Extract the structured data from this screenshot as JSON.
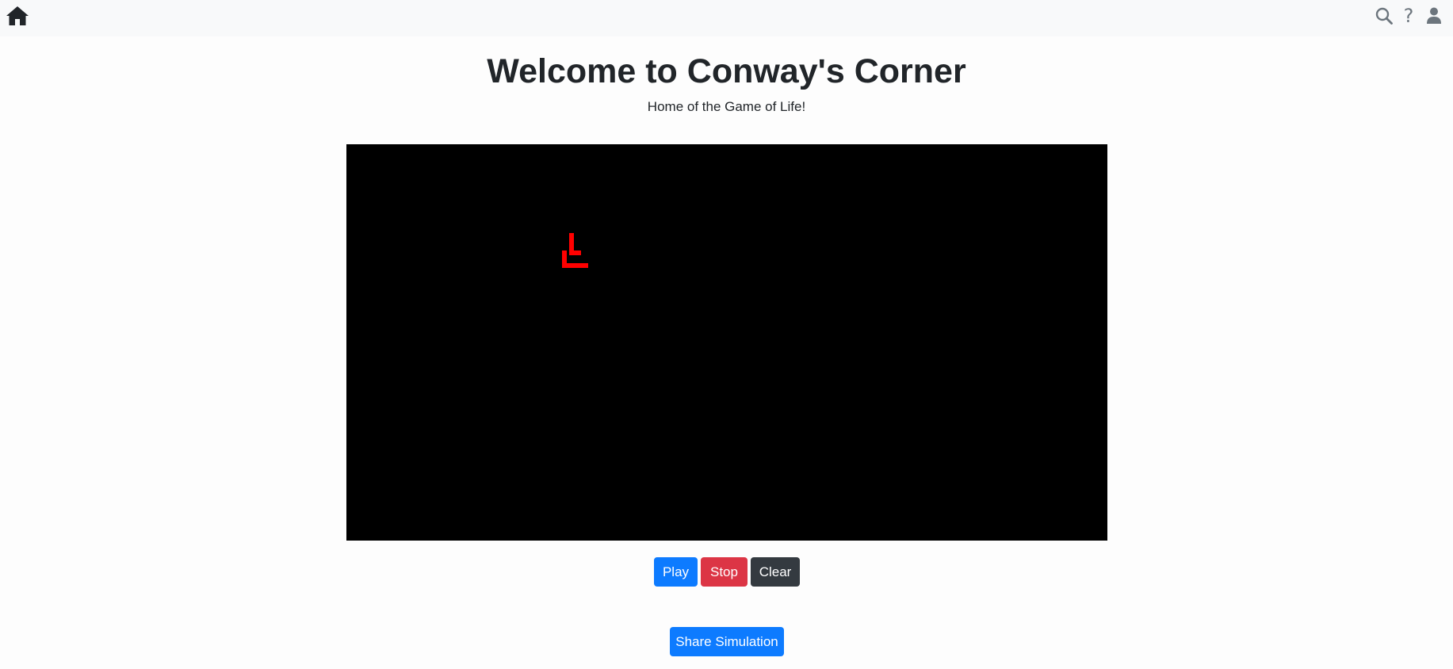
{
  "nav": {
    "home_icon": "home-icon",
    "search_icon": "search-icon",
    "help_icon": "?",
    "user_icon": "user-icon"
  },
  "header": {
    "title": "Welcome to Conway's Corner",
    "subtitle": "Home of the Game of Life!"
  },
  "board": {
    "background": "#000000",
    "live_cell_color": "#ff0000"
  },
  "controls": {
    "play_label": "Play",
    "stop_label": "Stop",
    "clear_label": "Clear",
    "share_label": "Share Simulation"
  },
  "colors": {
    "primary": "#0d7bff",
    "danger": "#dc3545",
    "dark": "#343a40"
  }
}
